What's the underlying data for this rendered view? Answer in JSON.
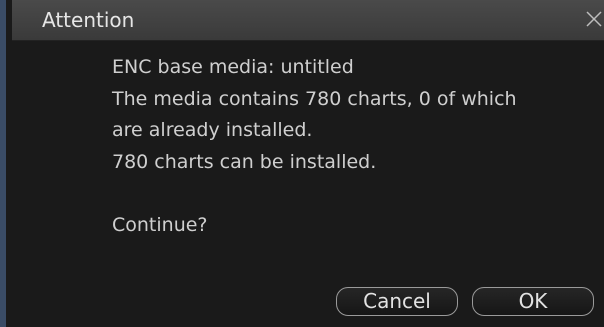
{
  "dialog": {
    "title": "Attention",
    "lines": [
      "ENC base media: untitled",
      "The media contains 780 charts, 0 of which",
      "are already installed.",
      "780 charts can be installed.",
      "Continue?"
    ],
    "buttons": {
      "cancel_label": "Cancel",
      "ok_label": "OK"
    },
    "icons": {
      "close": "close-icon"
    },
    "colors": {
      "background": "#1a1a1a",
      "titlebar": "#404040",
      "text": "#cfcfcf",
      "button_border": "#9a9a9a"
    }
  }
}
